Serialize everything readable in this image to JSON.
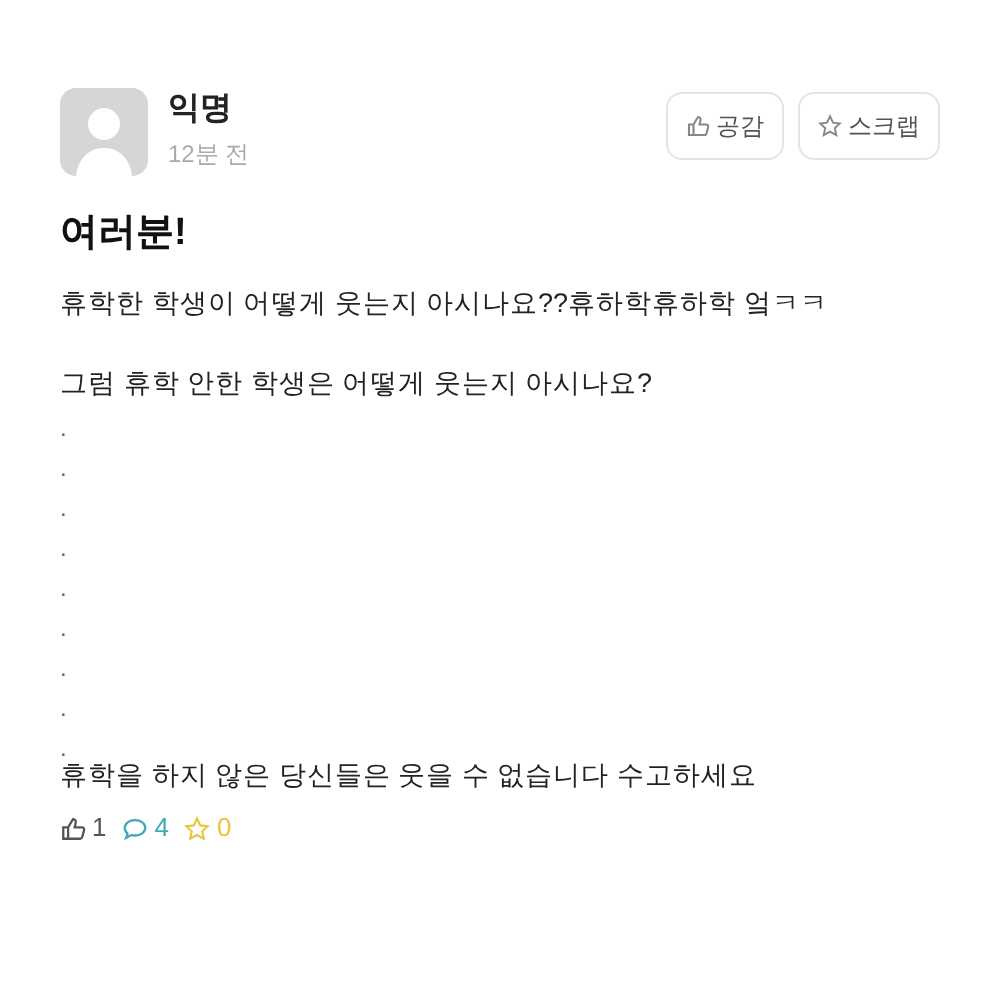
{
  "post": {
    "author": "익명",
    "time": "12분 전",
    "actions": [
      {
        "kind": "like",
        "label": "공감"
      },
      {
        "kind": "scrap",
        "label": "스크랩"
      }
    ],
    "title": "여러분!",
    "paragraphs": [
      "휴학한 학생이 어떻게 웃는지 아시나요??휴하학휴하학 엌ㅋㅋ",
      "그럼 휴학 안한 학생은 어떻게 웃는지 아시나요?"
    ],
    "dots": [
      ".",
      ".",
      ".",
      ".",
      ".",
      ".",
      ".",
      ".",
      "."
    ],
    "closing": "휴학을 하지 않은 당신들은 웃을 수 없습니다 수고하세요",
    "stats": [
      {
        "kind": "like",
        "count": "1",
        "color": "#555555"
      },
      {
        "kind": "comment",
        "count": "4",
        "color": "#3fa9b5"
      },
      {
        "kind": "scrap",
        "count": "0",
        "color": "#e8c53a"
      }
    ]
  }
}
